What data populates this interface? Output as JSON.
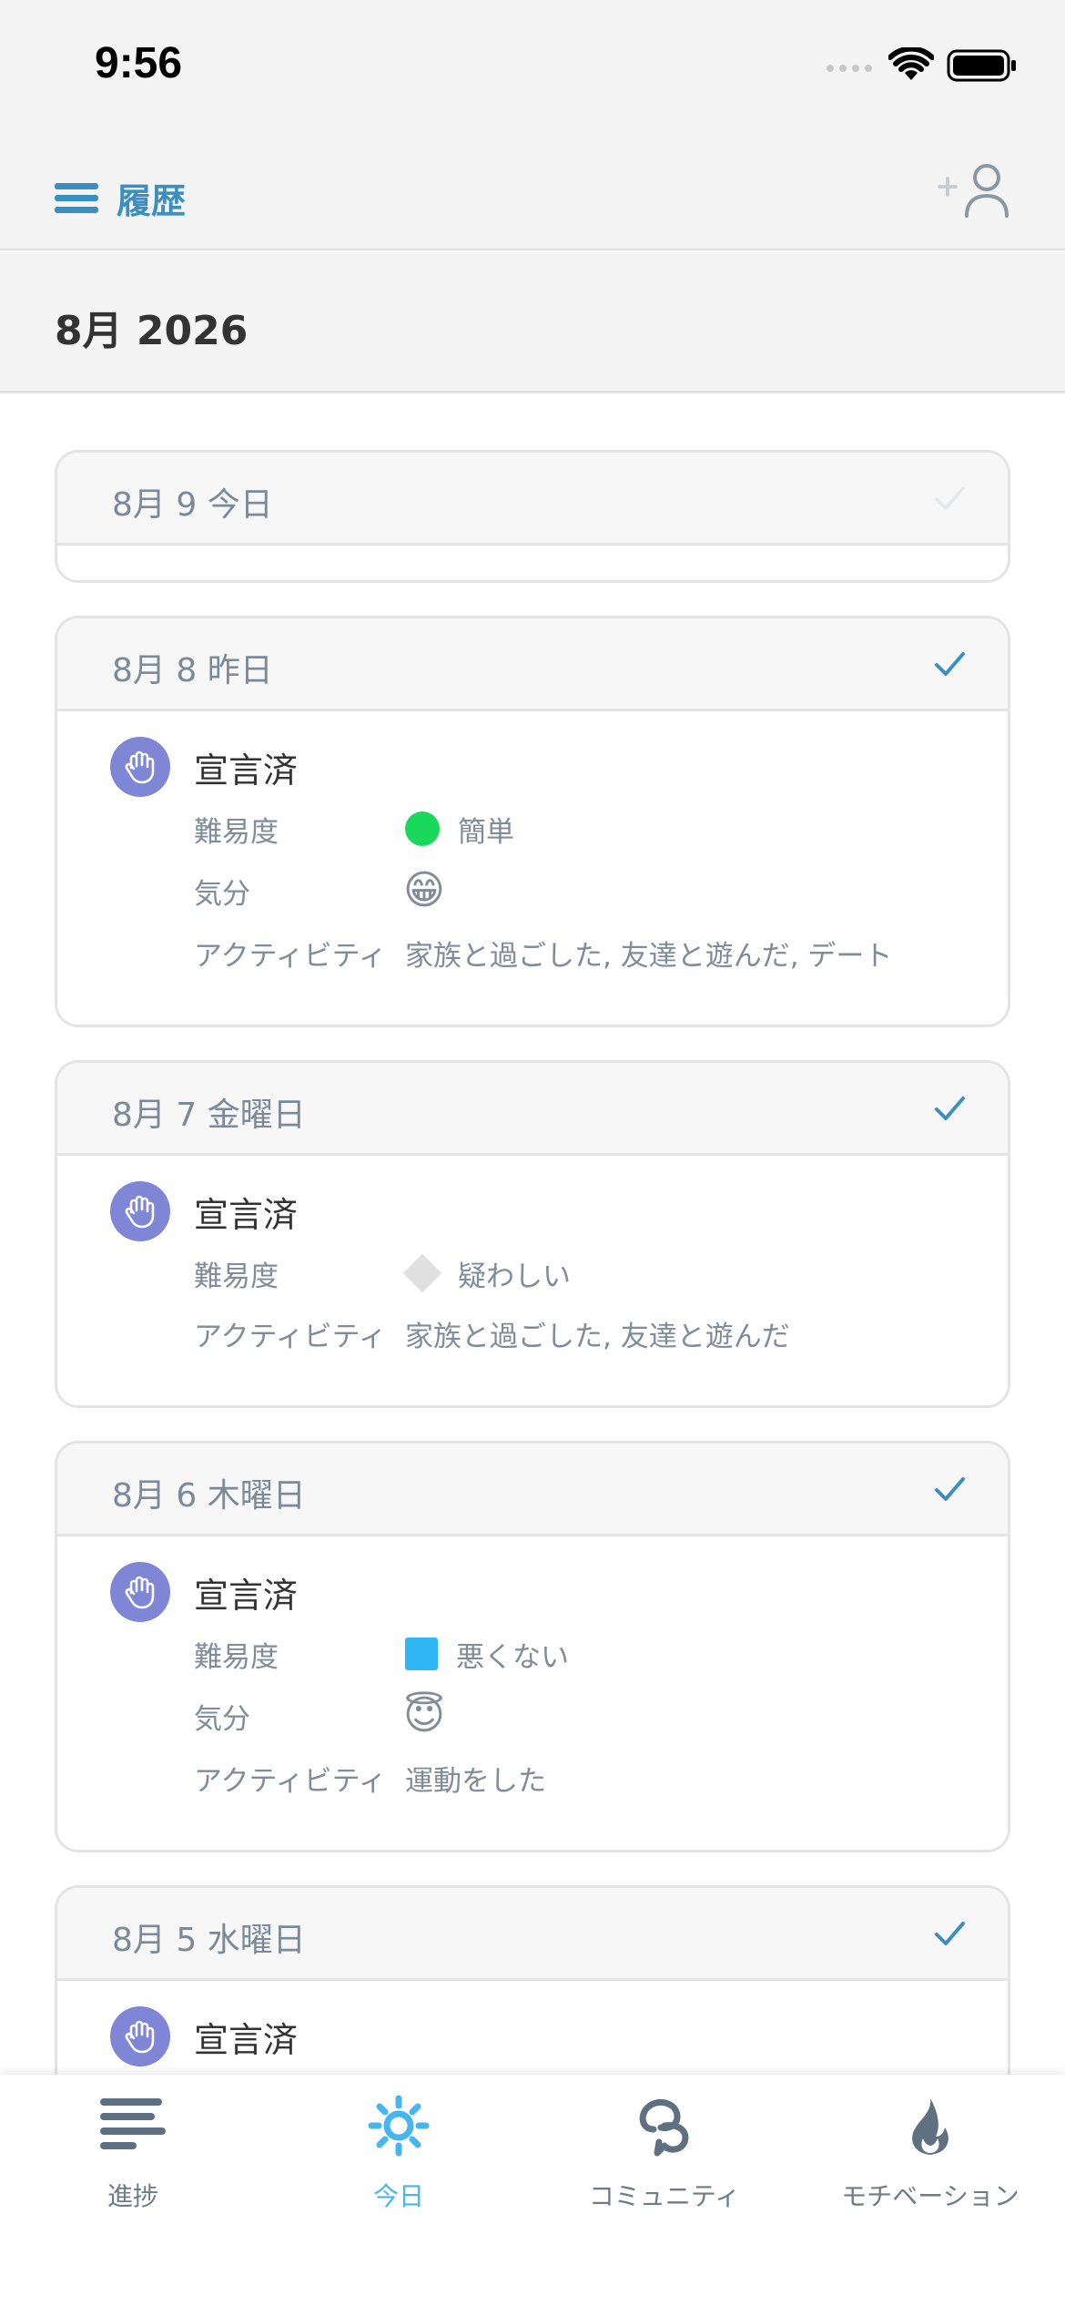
{
  "status_bar": {
    "time": "9:56"
  },
  "nav": {
    "title": "履歴"
  },
  "month": {
    "title": "8月 2026"
  },
  "labels": {
    "declared": "宣言済",
    "difficulty": "難易度",
    "mood": "気分",
    "activity": "アクティビティ"
  },
  "entries": [
    {
      "date": "8月 9 今日",
      "checked": true,
      "check_faded": true,
      "empty": true
    },
    {
      "date": "8月 8 昨日",
      "checked": true,
      "difficulty": "簡単",
      "difficulty_marker": "green-circle",
      "mood_emoji": "😁",
      "activity": "家族と過ごした, 友達と遊んだ, デート"
    },
    {
      "date": "8月 7 金曜日",
      "checked": true,
      "difficulty": "疑わしい",
      "difficulty_marker": "gray-diamond",
      "activity": "家族と過ごした, 友達と遊んだ"
    },
    {
      "date": "8月 6 木曜日",
      "checked": true,
      "difficulty": "悪くない",
      "difficulty_marker": "blue-square",
      "mood_emoji": "😇",
      "activity": "運動をした"
    },
    {
      "date": "8月 5 水曜日",
      "checked": true
    }
  ],
  "tabs": [
    {
      "label": "進捗",
      "icon": "progress-bars-icon",
      "active": false
    },
    {
      "label": "今日",
      "icon": "sun-icon",
      "active": true
    },
    {
      "label": "コミュニティ",
      "icon": "community-chat-icon",
      "active": false
    },
    {
      "label": "モチベーション",
      "icon": "flame-icon",
      "active": false
    }
  ],
  "colors": {
    "accent": "#3a8fc0",
    "active_tab": "#45b6ee",
    "badge": "#7f86d6",
    "easy": "#19d85c",
    "not_bad": "#2fb7f5"
  }
}
